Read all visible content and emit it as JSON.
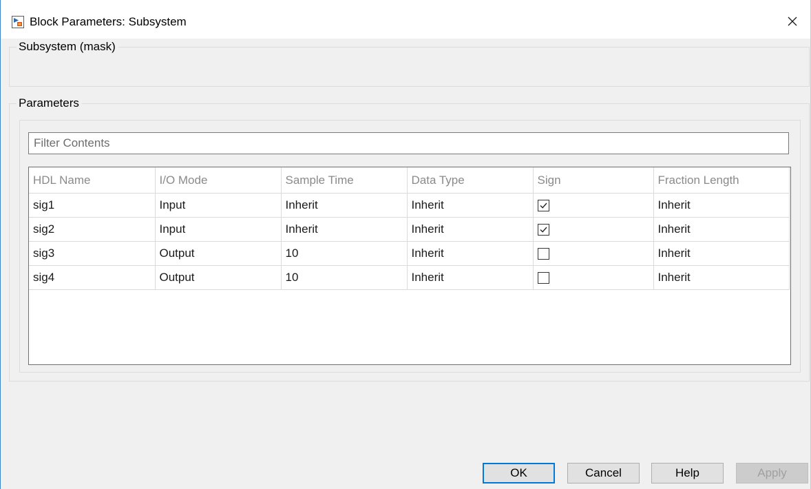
{
  "window": {
    "title": "Block Parameters: Subsystem",
    "app_icon": "simulink-block-icon",
    "close_icon": "close-icon"
  },
  "mask_group": {
    "legend": "Subsystem (mask)"
  },
  "parameters_group": {
    "legend": "Parameters"
  },
  "filter": {
    "placeholder": "Filter Contents",
    "value": ""
  },
  "table": {
    "columns": [
      "HDL Name",
      "I/O Mode",
      "Sample Time",
      "Data Type",
      "Sign",
      "Fraction Length"
    ],
    "rows": [
      {
        "hdl_name": "sig1",
        "io_mode": "Input",
        "sample_time": "Inherit",
        "data_type": "Inherit",
        "sign": true,
        "fraction_length": "Inherit"
      },
      {
        "hdl_name": "sig2",
        "io_mode": "Input",
        "sample_time": "Inherit",
        "data_type": "Inherit",
        "sign": true,
        "fraction_length": "Inherit"
      },
      {
        "hdl_name": "sig3",
        "io_mode": "Output",
        "sample_time": "10",
        "data_type": "Inherit",
        "sign": false,
        "fraction_length": "Inherit"
      },
      {
        "hdl_name": "sig4",
        "io_mode": "Output",
        "sample_time": "10",
        "data_type": "Inherit",
        "sign": false,
        "fraction_length": "Inherit"
      }
    ]
  },
  "buttons": {
    "ok": "OK",
    "cancel": "Cancel",
    "help": "Help",
    "apply": "Apply"
  },
  "colors": {
    "accent": "#0078d7",
    "window_border": "#3c84c8",
    "background": "#f0f0f0"
  }
}
